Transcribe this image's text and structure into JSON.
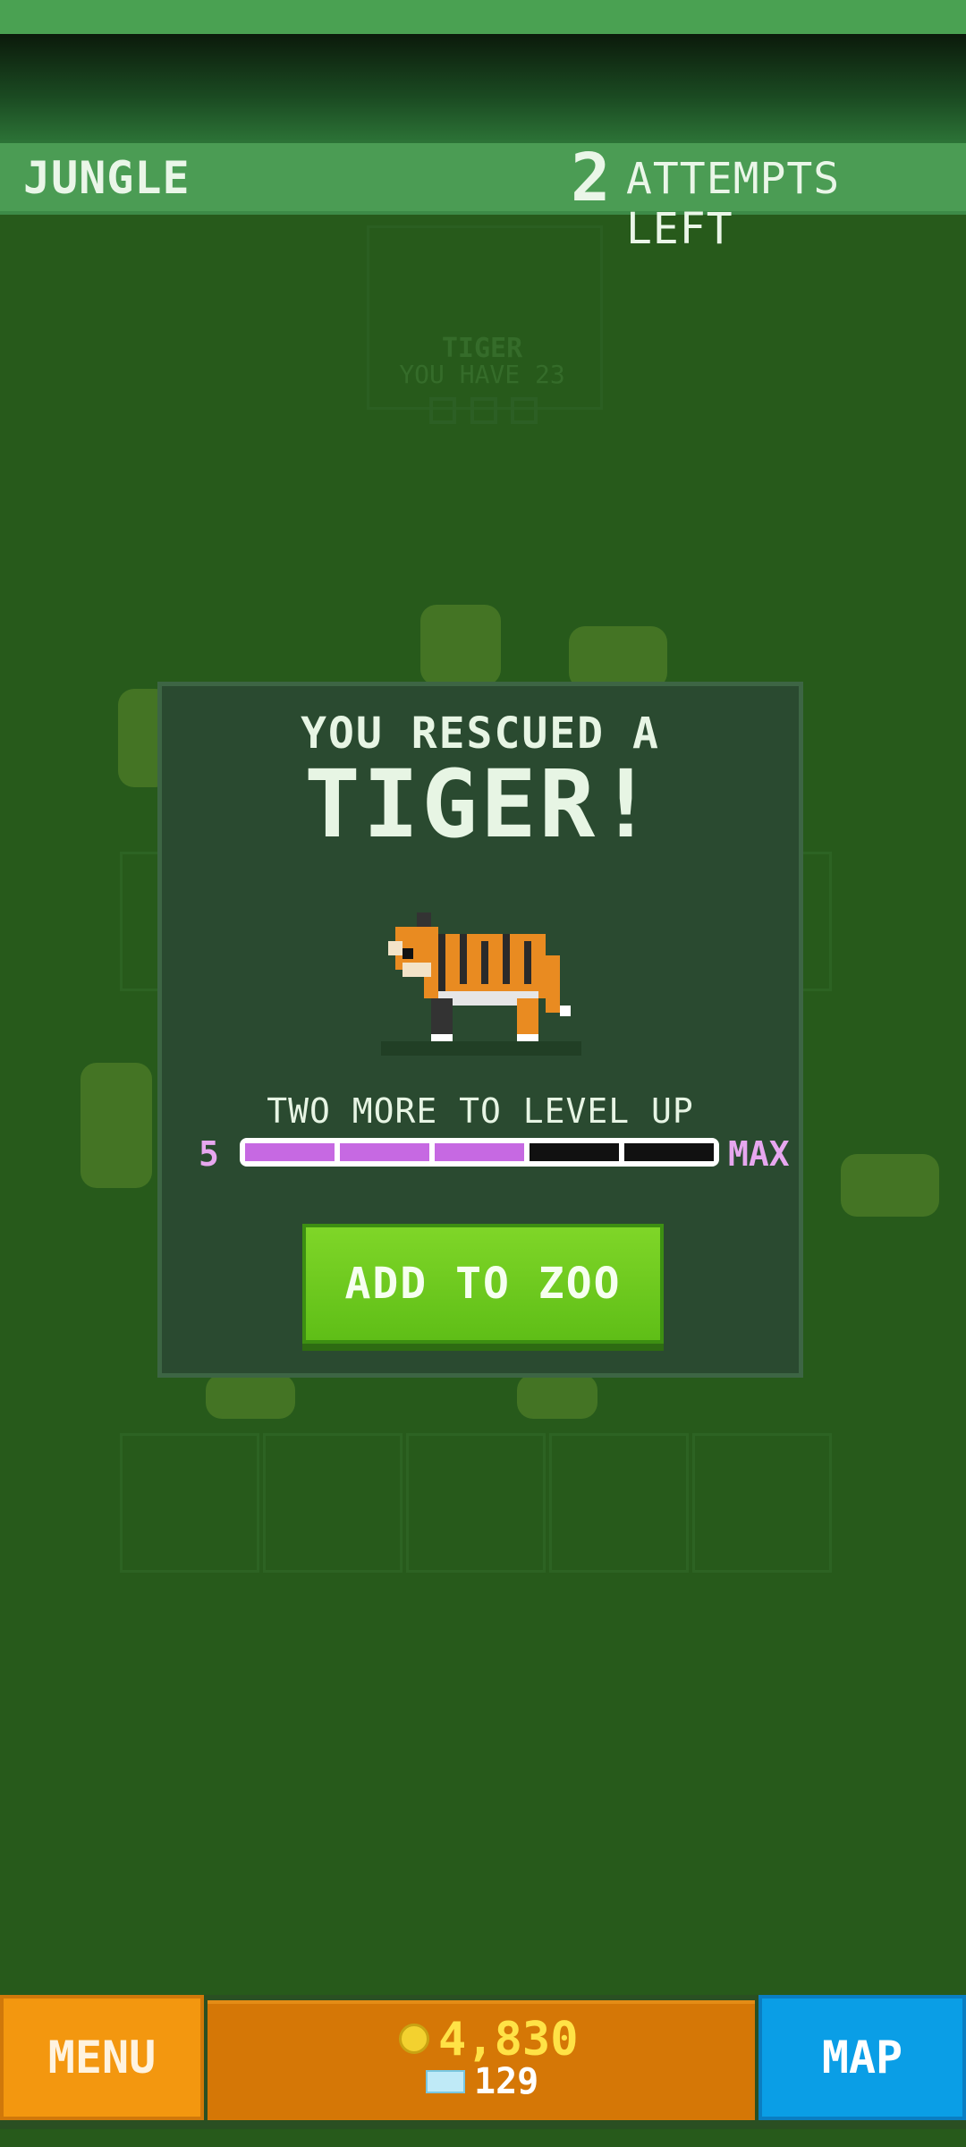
{
  "header": {
    "level_name": "JUNGLE",
    "attempts_count": "2",
    "attempts_label": "ATTEMPTS LEFT"
  },
  "background_card": {
    "animal": "TIGER",
    "subtitle": "YOU HAVE 23"
  },
  "popup": {
    "title_small": "YOU RESCUED A",
    "title_big": "TIGER!",
    "level_up_text": "TWO MORE TO LEVEL UP",
    "level_current": "5",
    "level_max_label": "MAX",
    "progress_filled_segments": 3,
    "progress_total_segments": 5,
    "add_button": "ADD TO ZOO"
  },
  "bottom": {
    "menu_label": "MENU",
    "coins": "4,830",
    "gems": "129",
    "map_label": "MAP"
  },
  "colors": {
    "background": "#275a1b",
    "header": "#4b9c54",
    "popup": "#2a4a30",
    "add_button": "#6bc81d",
    "menu_button": "#f3970f",
    "map_button": "#0a9ee6",
    "progress_fill": "#c669e2"
  }
}
